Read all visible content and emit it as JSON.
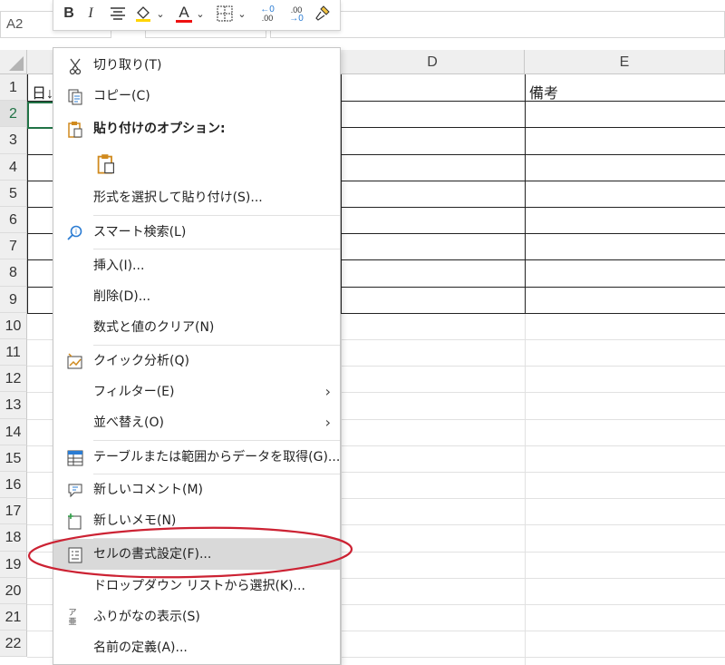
{
  "name_box": {
    "value": "A2"
  },
  "columns": [
    "D",
    "E"
  ],
  "rows": [
    "1",
    "2",
    "3",
    "4",
    "5",
    "6",
    "7",
    "8",
    "9",
    "10",
    "11",
    "12",
    "13",
    "14",
    "15",
    "16",
    "17",
    "18",
    "19",
    "20",
    "21",
    "22"
  ],
  "cells": {
    "A1": "日↓",
    "E1": "備考"
  },
  "mini_toolbar": {
    "bold": "B",
    "italic": "I",
    "font_color": "A",
    "inc_decimal": ".00",
    "dec_decimal": ".00"
  },
  "context_menu": {
    "cut": "切り取り(T)",
    "copy": "コピー(C)",
    "paste_options_header": "貼り付けのオプション:",
    "paste_special": "形式を選択して貼り付け(S)...",
    "smart_lookup": "スマート検索(L)",
    "insert": "挿入(I)...",
    "delete": "削除(D)...",
    "clear_contents": "数式と値のクリア(N)",
    "quick_analysis": "クイック分析(Q)",
    "filter": "フィルター(E)",
    "sort": "並べ替え(O)",
    "get_data": "テーブルまたは範囲からデータを取得(G)...",
    "new_comment": "新しいコメント(M)",
    "new_note": "新しいメモ(N)",
    "format_cells": "セルの書式設定(F)...",
    "pick_from_list": "ドロップダウン リストから選択(K)...",
    "phonetic": "ふりがなの表示(S)",
    "define_name": "名前の定義(A)...",
    "phonetic_icon_text": "ア亜"
  },
  "colors": {
    "accent": "#217346",
    "highlight_ellipse": "#cc2233",
    "paste_icon": "#d08a1e",
    "search_icon": "#2b7cd3"
  }
}
